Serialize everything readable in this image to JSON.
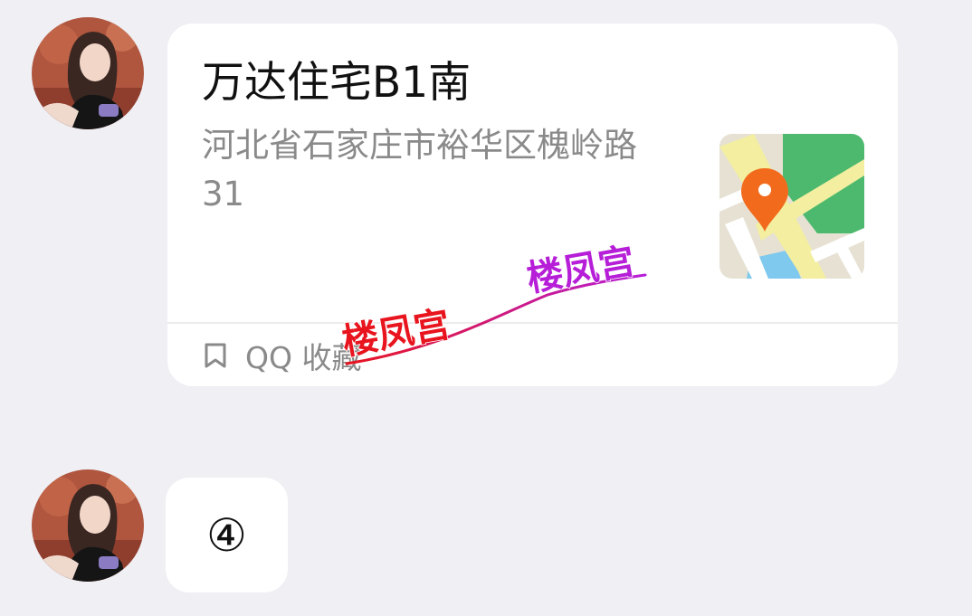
{
  "messages": [
    {
      "type": "location",
      "avatar_icon": "user-avatar-photo",
      "location": {
        "name": "万达住宅B1南",
        "address": "河北省石家庄市裕华区槐岭路31",
        "map_icon": "map-pin-icon"
      },
      "footer": {
        "icon": "bookmark-icon",
        "label": "QQ 收藏"
      },
      "watermark": {
        "text_1": "楼凤宫",
        "text_2": "楼凤宫",
        "color_1": "#e8141e",
        "color_2": "#b61ed8"
      }
    },
    {
      "type": "text",
      "avatar_icon": "user-avatar-photo",
      "text": "④"
    }
  ],
  "colors": {
    "background": "#efeff4",
    "bubble": "#ffffff",
    "title_text": "#111111",
    "secondary_text": "#8a8a8a",
    "map_park": "#4cb96e",
    "map_road": "#f3eea0",
    "map_pin": "#f26b1d",
    "map_water": "#7fc8ee"
  }
}
